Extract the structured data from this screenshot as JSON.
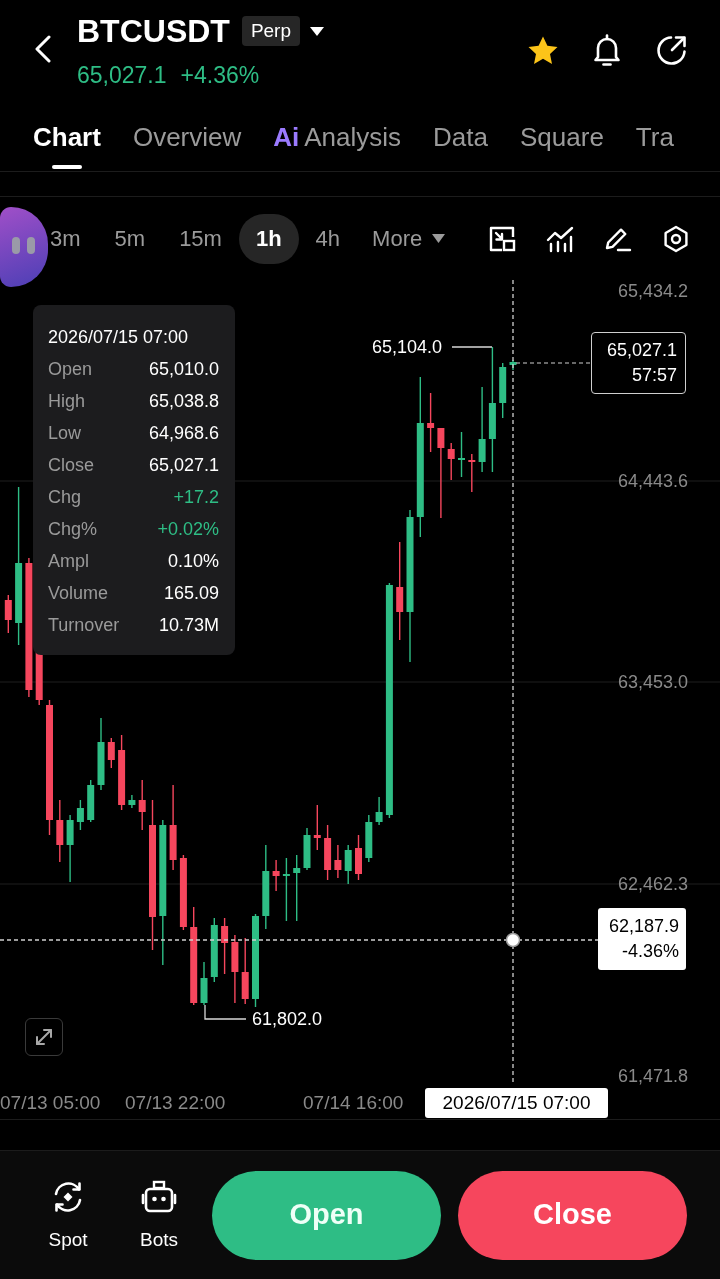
{
  "header": {
    "symbol": "BTCUSDT",
    "contract_type": "Perp",
    "price": "65,027.1",
    "change": "+4.36%",
    "favorited": true
  },
  "tabs": [
    {
      "label": "Chart",
      "selected": true
    },
    {
      "label": "Overview",
      "selected": false
    },
    {
      "badge": "Ai",
      "label": "Analysis",
      "selected": false
    },
    {
      "label": "Data",
      "selected": false
    },
    {
      "label": "Square",
      "selected": false
    },
    {
      "label": "Tra",
      "selected": false
    }
  ],
  "timeframes": [
    {
      "label": "3m",
      "selected": false
    },
    {
      "label": "5m",
      "selected": false
    },
    {
      "label": "15m",
      "selected": false
    },
    {
      "label": "1h",
      "selected": true
    },
    {
      "label": "4h",
      "selected": false
    }
  ],
  "more_menu": "More",
  "chart": {
    "price_axis": [
      "65,434.2",
      "64,443.6",
      "63,453.0",
      "62,462.3",
      "61,471.8"
    ],
    "time_axis": [
      "07/13 05:00",
      "07/13 22:00",
      "07/14 16:00"
    ],
    "high_marker": "65,104.0",
    "low_marker": "61,802.0",
    "last_price": "65,027.1",
    "countdown": "57:57",
    "crosshair": {
      "price": "62,187.9",
      "change": "-4.36%",
      "time": "2026/07/15 07:00"
    },
    "tooltip": {
      "time": "2026/07/15 07:00",
      "rows": [
        {
          "label": "Open",
          "value": "65,010.0",
          "color": "#ffffff"
        },
        {
          "label": "High",
          "value": "65,038.8",
          "color": "#ffffff"
        },
        {
          "label": "Low",
          "value": "64,968.6",
          "color": "#ffffff"
        },
        {
          "label": "Close",
          "value": "65,027.1",
          "color": "#ffffff"
        },
        {
          "label": "Chg",
          "value": "+17.2",
          "color": "#2ebd85"
        },
        {
          "label": "Chg%",
          "value": "+0.02%",
          "color": "#2ebd85"
        },
        {
          "label": "Ampl",
          "value": "0.10%",
          "color": "#ffffff"
        },
        {
          "label": "Volume",
          "value": "165.09",
          "color": "#ffffff"
        },
        {
          "label": "Turnover",
          "value": "10.73M",
          "color": "#ffffff"
        }
      ]
    }
  },
  "bottom_bar": {
    "shortcuts": [
      {
        "kind": "spot",
        "label": "Spot"
      },
      {
        "kind": "bots",
        "label": "Bots"
      }
    ],
    "open_button": "Open",
    "close_button": "Close"
  }
}
